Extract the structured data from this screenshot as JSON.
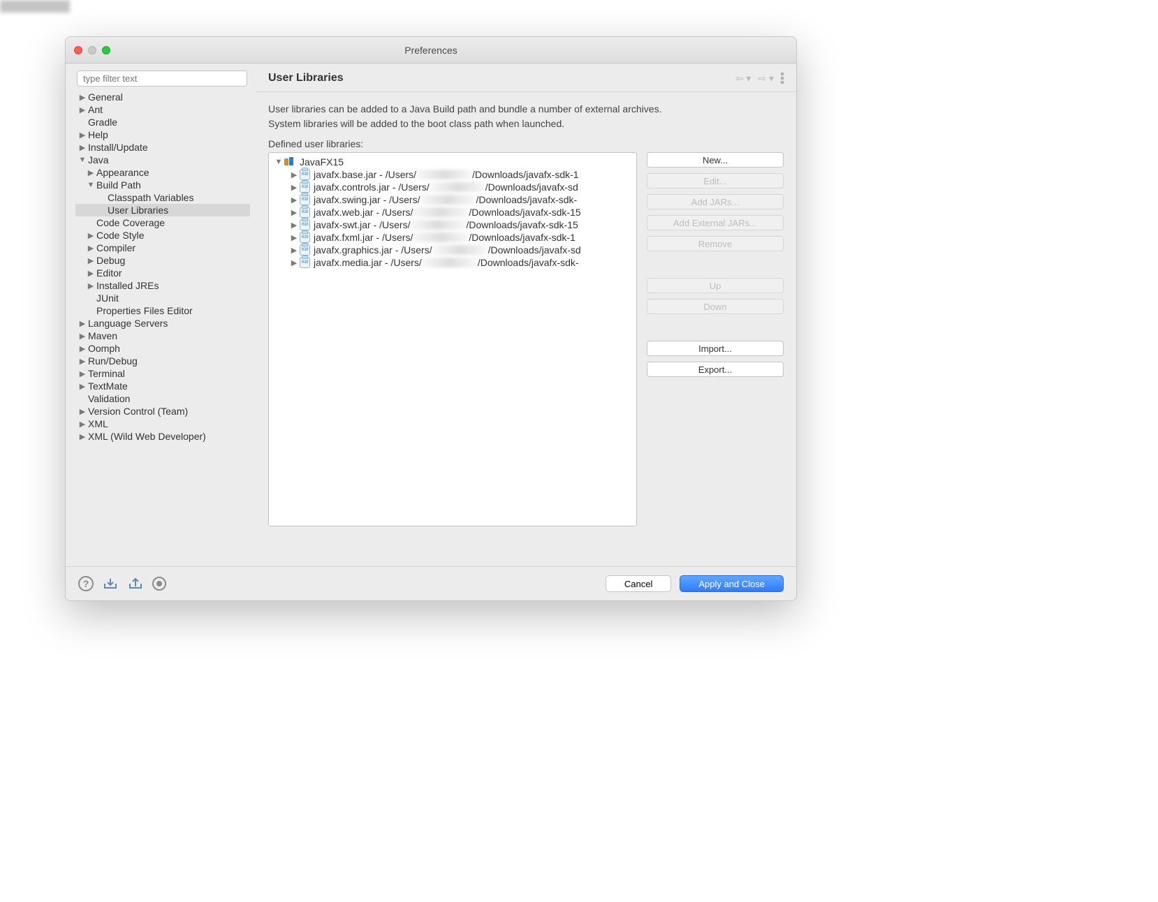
{
  "window": {
    "title": "Preferences"
  },
  "sidebar": {
    "filter_placeholder": "type filter text",
    "items": [
      {
        "label": "General",
        "depth": 0,
        "arrow": "right"
      },
      {
        "label": "Ant",
        "depth": 0,
        "arrow": "right"
      },
      {
        "label": "Gradle",
        "depth": 0,
        "arrow": "none"
      },
      {
        "label": "Help",
        "depth": 0,
        "arrow": "right"
      },
      {
        "label": "Install/Update",
        "depth": 0,
        "arrow": "right"
      },
      {
        "label": "Java",
        "depth": 0,
        "arrow": "down"
      },
      {
        "label": "Appearance",
        "depth": 1,
        "arrow": "right"
      },
      {
        "label": "Build Path",
        "depth": 1,
        "arrow": "down"
      },
      {
        "label": "Classpath Variables",
        "depth": 2,
        "arrow": "none"
      },
      {
        "label": "User Libraries",
        "depth": 2,
        "arrow": "none",
        "selected": true
      },
      {
        "label": "Code Coverage",
        "depth": 1,
        "arrow": "none"
      },
      {
        "label": "Code Style",
        "depth": 1,
        "arrow": "right"
      },
      {
        "label": "Compiler",
        "depth": 1,
        "arrow": "right"
      },
      {
        "label": "Debug",
        "depth": 1,
        "arrow": "right"
      },
      {
        "label": "Editor",
        "depth": 1,
        "arrow": "right"
      },
      {
        "label": "Installed JREs",
        "depth": 1,
        "arrow": "right"
      },
      {
        "label": "JUnit",
        "depth": 1,
        "arrow": "none"
      },
      {
        "label": "Properties Files Editor",
        "depth": 1,
        "arrow": "none"
      },
      {
        "label": "Language Servers",
        "depth": 0,
        "arrow": "right"
      },
      {
        "label": "Maven",
        "depth": 0,
        "arrow": "right"
      },
      {
        "label": "Oomph",
        "depth": 0,
        "arrow": "right"
      },
      {
        "label": "Run/Debug",
        "depth": 0,
        "arrow": "right"
      },
      {
        "label": "Terminal",
        "depth": 0,
        "arrow": "right"
      },
      {
        "label": "TextMate",
        "depth": 0,
        "arrow": "right"
      },
      {
        "label": "Validation",
        "depth": 0,
        "arrow": "none"
      },
      {
        "label": "Version Control (Team)",
        "depth": 0,
        "arrow": "right"
      },
      {
        "label": "XML",
        "depth": 0,
        "arrow": "right"
      },
      {
        "label": "XML (Wild Web Developer)",
        "depth": 0,
        "arrow": "right"
      }
    ]
  },
  "main": {
    "title": "User Libraries",
    "desc_line1": "User libraries can be added to a Java Build path and bundle a number of external archives.",
    "desc_line2": "System libraries will be added to the boot class path when launched.",
    "defined_label": "Defined user libraries:",
    "library": {
      "name": "JavaFX15"
    },
    "jars": [
      {
        "prefix": "javafx.base.jar - /Users/",
        "suffix": "/Downloads/javafx-sdk-1"
      },
      {
        "prefix": "javafx.controls.jar - /Users/",
        "suffix": "/Downloads/javafx-sd"
      },
      {
        "prefix": "javafx.swing.jar - /Users/",
        "suffix": "/Downloads/javafx-sdk-"
      },
      {
        "prefix": "javafx.web.jar - /Users/",
        "suffix": "/Downloads/javafx-sdk-15"
      },
      {
        "prefix": "javafx-swt.jar - /Users/",
        "suffix": "/Downloads/javafx-sdk-15"
      },
      {
        "prefix": "javafx.fxml.jar - /Users/",
        "suffix": "/Downloads/javafx-sdk-1"
      },
      {
        "prefix": "javafx.graphics.jar - /Users/",
        "suffix": "/Downloads/javafx-sd"
      },
      {
        "prefix": "javafx.media.jar - /Users/",
        "suffix": "/Downloads/javafx-sdk-"
      }
    ],
    "actions": {
      "new_label": "New...",
      "edit_label": "Edit...",
      "add_jars_label": "Add JARs...",
      "add_ext_jars_label": "Add External JARs...",
      "remove_label": "Remove",
      "up_label": "Up",
      "down_label": "Down",
      "import_label": "Import...",
      "export_label": "Export..."
    }
  },
  "footer": {
    "cancel_label": "Cancel",
    "apply_label": "Apply and Close"
  }
}
